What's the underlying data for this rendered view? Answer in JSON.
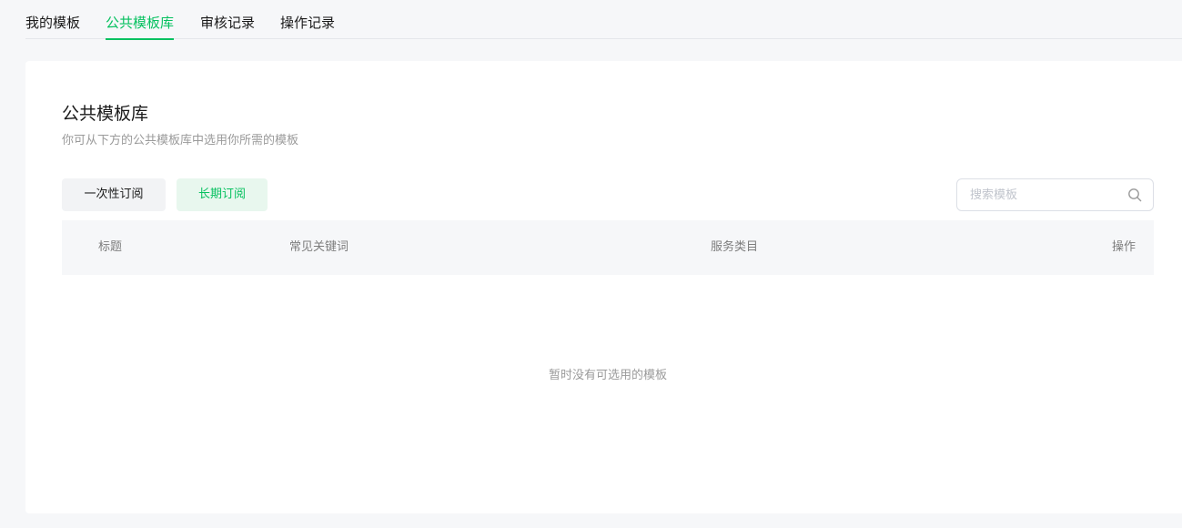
{
  "tabs": [
    {
      "label": "我的模板",
      "active": false
    },
    {
      "label": "公共模板库",
      "active": true
    },
    {
      "label": "审核记录",
      "active": false
    },
    {
      "label": "操作记录",
      "active": false
    }
  ],
  "card": {
    "title": "公共模板库",
    "description": "你可从下方的公共模板库中选用你所需的模板"
  },
  "filters": {
    "once_label": "一次性订阅",
    "long_term_label": "长期订阅",
    "selected": "长期订阅"
  },
  "search": {
    "placeholder": "搜索模板",
    "value": "",
    "icon": "search-icon"
  },
  "table": {
    "columns": [
      "标题",
      "常见关键词",
      "服务类目",
      "操作"
    ],
    "rows": [],
    "empty_text": "暂时没有可选用的模板"
  },
  "colors": {
    "accent": "#07c160",
    "accent_bg": "#e8f7ee",
    "page_bg": "#f6f7f9",
    "muted_text": "#9a9a9a"
  }
}
